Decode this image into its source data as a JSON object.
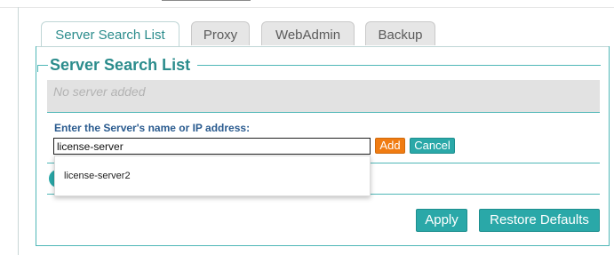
{
  "tabs": [
    {
      "label": "Server Search List",
      "active": true
    },
    {
      "label": "Proxy",
      "active": false
    },
    {
      "label": "WebAdmin",
      "active": false
    },
    {
      "label": "Backup",
      "active": false
    }
  ],
  "section": {
    "legend": "Server Search List",
    "empty_text": "No server added"
  },
  "server_input": {
    "label": "Enter the Server's name or IP address:",
    "value": "license-server"
  },
  "autocomplete": {
    "suggestions": [
      "license-server2"
    ]
  },
  "buttons": {
    "add": "Add",
    "cancel": "Cancel",
    "apply": "Apply",
    "restore": "Restore Defaults"
  },
  "colors": {
    "accent_teal": "#2aa8a8",
    "accent_orange": "#f07c12",
    "legend_teal": "#2b8c8c",
    "label_blue": "#2a5b8f"
  }
}
